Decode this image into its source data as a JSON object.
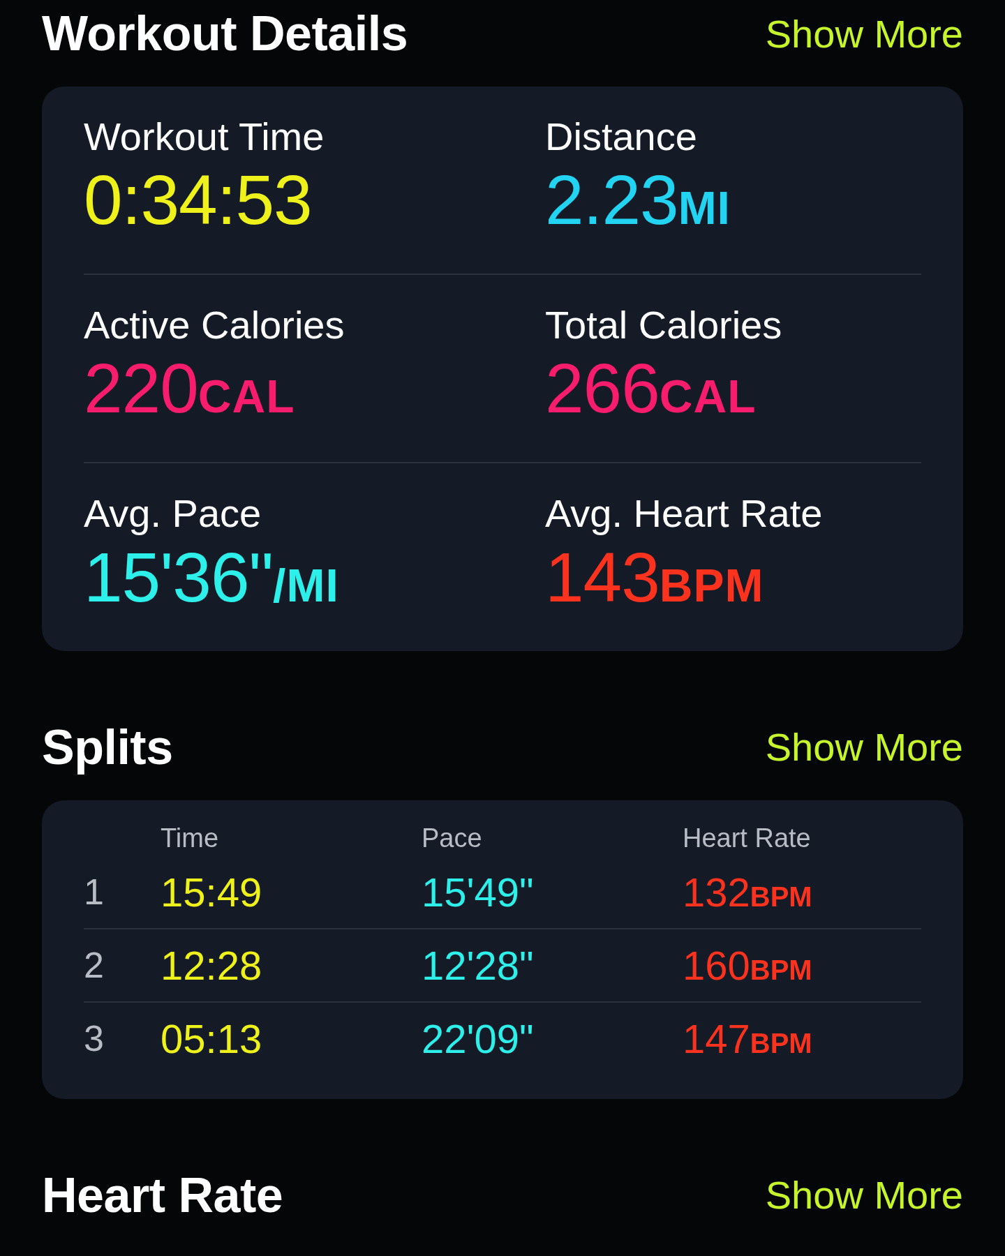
{
  "sections": [
    {
      "kind": "metrics",
      "title": "Workout Details",
      "action": "Show More",
      "metrics": [
        {
          "label": "Workout Time",
          "value": "0:34:53",
          "color": "#eef21a"
        },
        {
          "label": "Distance",
          "value": "2.23",
          "unit": "MI",
          "color": "#22d3f2"
        },
        {
          "label": "Active Calories",
          "value": "220",
          "unit": "CAL",
          "color": "#f81c6c"
        },
        {
          "label": "Total Calories",
          "value": "266",
          "unit": "CAL",
          "color": "#f81c6c"
        },
        {
          "label": "Avg. Pace",
          "value": "15'36\"",
          "unit": "/MI",
          "color": "#2ef0ea"
        },
        {
          "label": "Avg. Heart Rate",
          "value": "143",
          "unit": "BPM",
          "color": "#fa321e"
        }
      ]
    },
    {
      "kind": "splits",
      "title": "Splits",
      "action": "Show More",
      "columns": [
        {
          "label": "Time",
          "color": "#eef21a"
        },
        {
          "label": "Pace",
          "color": "#2ef0ea"
        },
        {
          "label": "Heart Rate",
          "color": "#fa321e"
        }
      ],
      "rows": [
        {
          "index": "1",
          "cells": [
            {
              "value": "15:49"
            },
            {
              "value": "15'49\""
            },
            {
              "value": "132",
              "unit": "BPM"
            }
          ]
        },
        {
          "index": "2",
          "cells": [
            {
              "value": "12:28"
            },
            {
              "value": "12'28\""
            },
            {
              "value": "160",
              "unit": "BPM"
            }
          ]
        },
        {
          "index": "3",
          "cells": [
            {
              "value": "05:13"
            },
            {
              "value": "22'09\""
            },
            {
              "value": "147",
              "unit": "BPM"
            }
          ]
        }
      ]
    },
    {
      "kind": "header",
      "title": "Heart Rate",
      "action": "Show More"
    }
  ]
}
